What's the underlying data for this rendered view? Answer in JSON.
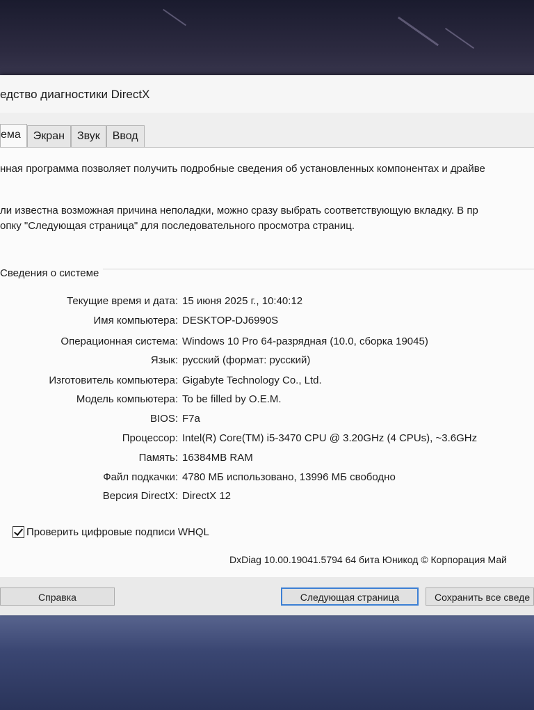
{
  "window": {
    "title": "едство диагностики DirectX"
  },
  "tabs": [
    {
      "label": "ема",
      "active": true
    },
    {
      "label": "Экран",
      "active": false
    },
    {
      "label": "Звук",
      "active": false
    },
    {
      "label": "Ввод",
      "active": false
    }
  ],
  "intro": {
    "line1": "нная программа позволяет получить подробные сведения об установленных компонентах и драйве",
    "line2": "ли известна возможная причина неполадки, можно сразу выбрать соответствующую вкладку. В пр",
    "line3": "опку \"Следующая страница\" для последовательного просмотра страниц."
  },
  "system_info": {
    "section_title": "Сведения о системе",
    "rows": [
      {
        "label": "Текущие время и дата:",
        "value": "15 июня 2025 г., 10:40:12"
      },
      {
        "label": "Имя компьютера:",
        "value": "DESKTOP-DJ6990S"
      },
      {
        "label": "Операционная система:",
        "value": "Windows 10 Pro 64-разрядная (10.0, сборка 19045)"
      },
      {
        "label": "Язык:",
        "value": "русский (формат: русский)"
      },
      {
        "label": "Изготовитель компьютера:",
        "value": "Gigabyte Technology Co., Ltd."
      },
      {
        "label": "Модель компьютера:",
        "value": "To be filled by O.E.M."
      },
      {
        "label": "BIOS:",
        "value": "F7a"
      },
      {
        "label": "Процессор:",
        "value": "Intel(R) Core(TM) i5-3470 CPU @ 3.20GHz (4 CPUs), ~3.6GHz"
      },
      {
        "label": "Память:",
        "value": "16384MB RAM"
      },
      {
        "label": "Файл подкачки:",
        "value": "4780 МБ использовано, 13996 МБ свободно"
      },
      {
        "label": "Версия DirectX:",
        "value": "DirectX 12"
      }
    ]
  },
  "whql_checkbox": {
    "label": "Проверить цифровые подписи WHQL",
    "checked": true
  },
  "version_line": "DxDiag 10.00.19041.5794 64 бита Юникод © Корпорация Май",
  "buttons": {
    "help": "Справка",
    "next_page": "Следующая страница",
    "save_all": "Сохранить все сведе"
  }
}
